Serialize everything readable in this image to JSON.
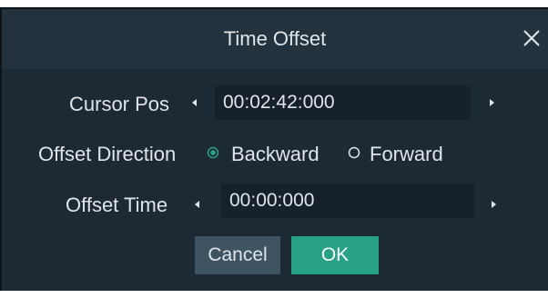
{
  "dialog": {
    "title": "Time Offset"
  },
  "cursor_pos": {
    "label": "Cursor Pos",
    "value": "00:02:42:000"
  },
  "offset_direction": {
    "label": "Offset Direction",
    "options": [
      {
        "label": "Backward",
        "selected": true
      },
      {
        "label": "Forward",
        "selected": false
      }
    ]
  },
  "offset_time": {
    "label": "Offset Time",
    "value": "00:00:000"
  },
  "buttons": {
    "cancel": "Cancel",
    "ok": "OK"
  },
  "colors": {
    "accent": "#27a287",
    "dialog_bg": "#1e2a33",
    "field_bg": "#17212a"
  },
  "icons": {
    "close": "close-icon",
    "left": "triangle-left-icon",
    "right": "triangle-right-icon"
  }
}
